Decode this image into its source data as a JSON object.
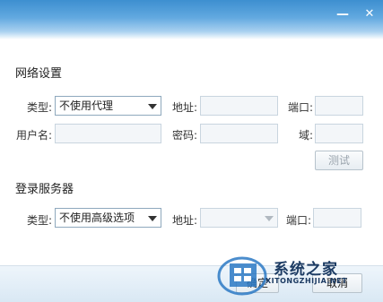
{
  "window": {
    "minimize_icon": "minimize-icon",
    "close_icon": "close-icon"
  },
  "network": {
    "title": "网络设置",
    "type_label": "类型:",
    "type_value": "不使用代理",
    "address_label": "地址:",
    "port_label": "端口:",
    "username_label": "用户名:",
    "password_label": "密码:",
    "domain_label": "域:",
    "test_button": "测试"
  },
  "login_server": {
    "title": "登录服务器",
    "type_label": "类型:",
    "type_value": "不使用高级选项",
    "address_label": "地址:",
    "port_label": "端口:"
  },
  "footer": {
    "ok_button": "确定",
    "cancel_button": "取消"
  },
  "watermark": {
    "brand": "系统之家",
    "url": "XITONGZHIJIA.NET"
  },
  "colors": {
    "titlebar_top": "#3d8fd0",
    "titlebar_bottom": "#a9d1f0",
    "footer": "#d9e8f4"
  }
}
